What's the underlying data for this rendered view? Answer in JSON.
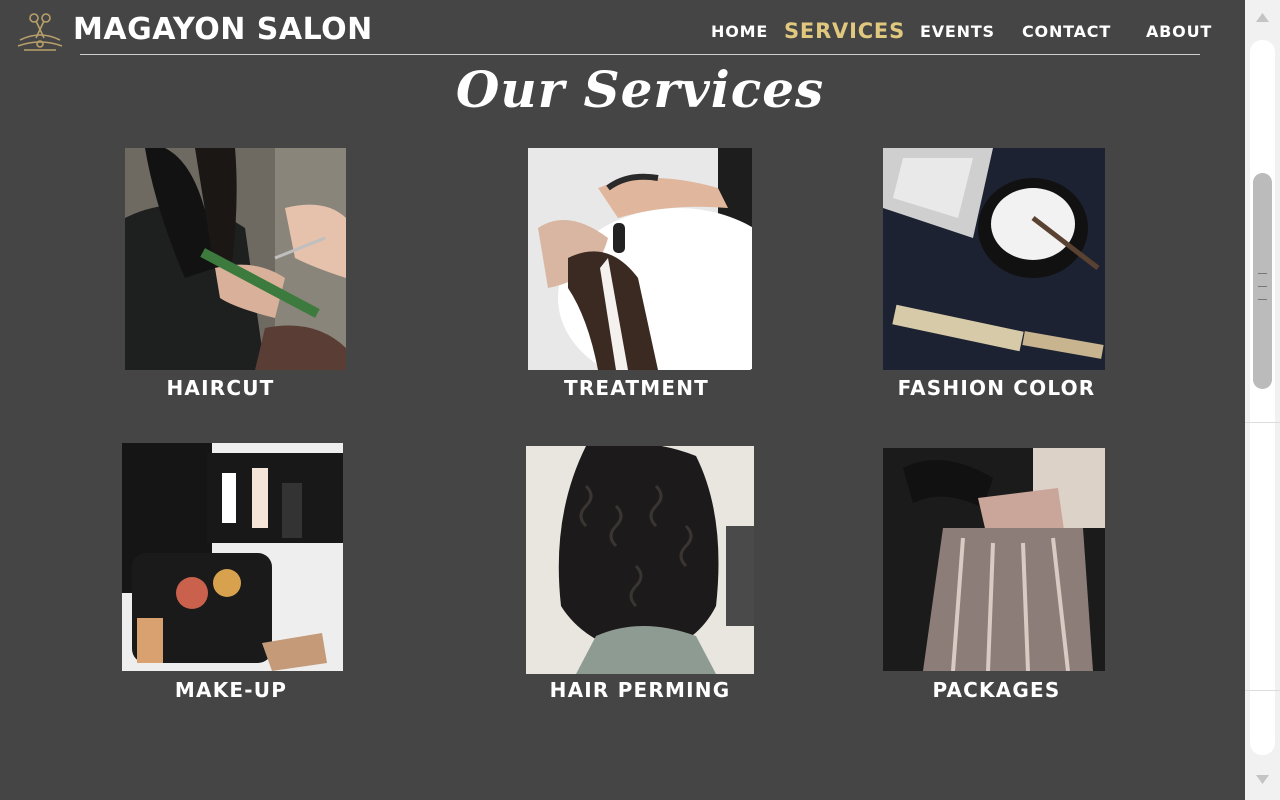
{
  "header": {
    "brand": "MAGAYON SALON",
    "logo_icon": "scissors-crest-logo-icon",
    "nav": [
      {
        "label": "HOME",
        "active": false
      },
      {
        "label": "SERVICES",
        "active": true
      },
      {
        "label": "EVENTS",
        "active": false
      },
      {
        "label": "CONTACT",
        "active": false
      },
      {
        "label": "ABOUT",
        "active": false
      }
    ]
  },
  "section_title": "Our Services",
  "services": [
    {
      "label": "HAIRCUT",
      "image": "haircut-photo"
    },
    {
      "label": "TREATMENT",
      "image": "hair-wash-treatment-photo"
    },
    {
      "label": "FASHION COLOR",
      "image": "hair-color-bowl-photo"
    },
    {
      "label": "MAKE-UP",
      "image": "makeup-kit-photo"
    },
    {
      "label": "HAIR PERMING",
      "image": "curly-hair-photo"
    },
    {
      "label": "PACKAGES",
      "image": "foil-highlights-photo"
    }
  ],
  "colors": {
    "background": "#454545",
    "accent": "#e0c97f",
    "text": "#ffffff"
  },
  "scrollbar": {
    "up_icon": "scroll-up-arrow-icon",
    "down_icon": "scroll-down-arrow-icon"
  }
}
